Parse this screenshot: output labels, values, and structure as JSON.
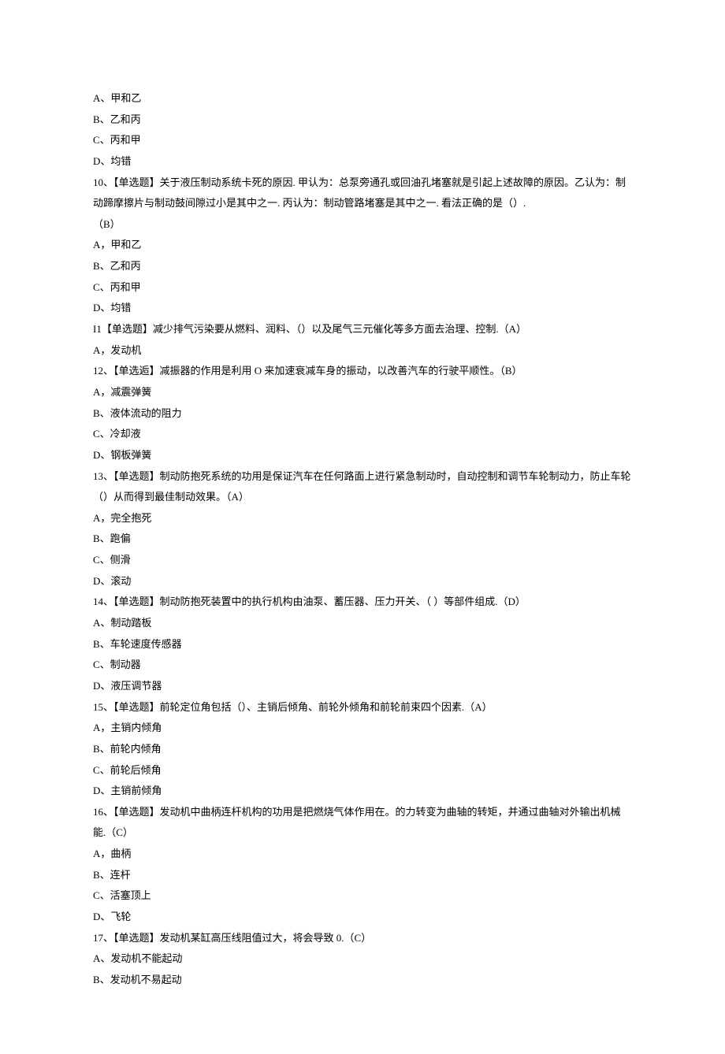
{
  "lines": [
    "A、甲和乙",
    "B、乙和丙",
    "C、丙和甲",
    "D、均错",
    "10、【单选题】关于液压制动系统卡死的原因. 甲认为：总泵旁通孔或回油孔堵塞就是引起上述故障的原因。乙认为：制动蹄摩擦片与制动鼓间隙过小是其中之一. 丙认为：制动管路堵塞是其中之一. 看法正确的是（）.",
    "（B）",
    "A，甲和乙",
    "B、乙和丙",
    "C、丙和甲",
    "D、均错",
    "I1【单选题】减少排气污染要从燃料、润料、（）以及尾气三元催化等多方面去治理、控制.（A）",
    "A，发动机",
    "12、【单选逅】减振器的作用是利用 O 来加速衰减车身的振动，以改善汽车的行驶平顺性。（B）",
    "A，减震弹簧",
    "B、液体流动的阻力",
    "C、冷却液",
    "D、钢板弹簧",
    "13、【单选题】制动防抱死系统的功用是保证汽车在任何路面上进行紧急制动时，自动控制和调节车轮制动力，防止车轮（）从而得到最佳制动效果。（A）",
    "A，完全抱死",
    "B、跑偏",
    "C、侧滑",
    "D、滚动",
    "14、【单选题】制动防抱死装置中的执行机构由油泵、蓄压器、压力开关、（ ）等部件组成.（D）",
    "A、制动踏板",
    "B、车轮速度传感器",
    "C、制动器",
    "D、液压调节器",
    "15、【单选题】前轮定位角包括（）、主销后倾角、前轮外倾角和前轮前束四个因素.（A）",
    "A，主销内倾角",
    "B、前轮内倾角",
    "C、前轮后倾角",
    "D、主销前倾角",
    "16、【单选题】发动机中曲柄连杆机构的功用是把燃烧气体作用在。的力转变为曲轴的转矩，并通过曲轴对外输出机械能.（C）",
    "A，曲柄",
    "B、连杆",
    "C、活塞顶上",
    "D、飞轮",
    "17、【单选题】发动机某缸高压线阻值过大，将会导致 0.（C）",
    "A、发动机不能起动",
    "B、发动机不易起动"
  ]
}
